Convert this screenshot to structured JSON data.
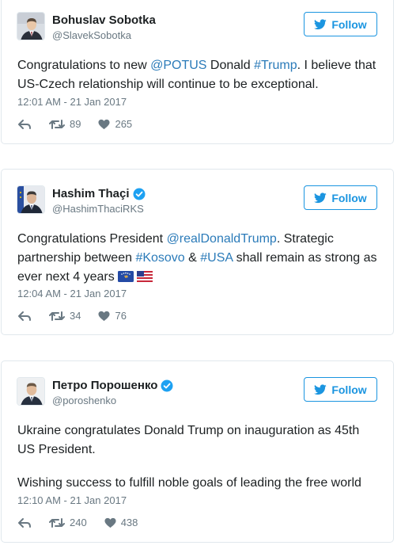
{
  "colors": {
    "link": "#2b7bb9",
    "follow_blue": "#1b95e0",
    "meta_gray": "#697882",
    "text": "#1c2022",
    "verified_blue": "#1da1f2"
  },
  "tweets": [
    {
      "author": "Bohuslav Sobotka",
      "handle": "@SlavekSobotka",
      "verified": false,
      "follow_label": "Follow",
      "text": {
        "p1": "Congratulations to new ",
        "m1": "@POTUS",
        "p2": " Donald ",
        "h1": "#Trump",
        "p3": ". I believe that US-Czech relationship will continue to be exceptional."
      },
      "timestamp": "12:01 AM - 21 Jan 2017",
      "retweets": "89",
      "likes": "265"
    },
    {
      "author": "Hashim Thaçi",
      "handle": "@HashimThaciRKS",
      "verified": true,
      "follow_label": "Follow",
      "text": {
        "p1": "Congratulations President ",
        "m1": "@realDonaldTrump",
        "p2": ". Strategic partnership between ",
        "h1": "#Kosovo",
        "p3": " & ",
        "h2": "#USA",
        "p4": " shall remain as strong as ever next 4 years"
      },
      "flags": [
        "kosovo-flag-icon",
        "us-flag-icon"
      ],
      "timestamp": "12:04 AM - 21 Jan 2017",
      "retweets": "34",
      "likes": "76"
    },
    {
      "author": "Петро Порошенко",
      "handle": "@poroshenko",
      "verified": true,
      "follow_label": "Follow",
      "text": {
        "para1": "Ukraine congratulates Donald Trump on inauguration as 45th US President.",
        "para2": "Wishing success to fulfill noble goals of leading the free world"
      },
      "timestamp": "12:10 AM - 21 Jan 2017",
      "retweets": "240",
      "likes": "438"
    }
  ]
}
